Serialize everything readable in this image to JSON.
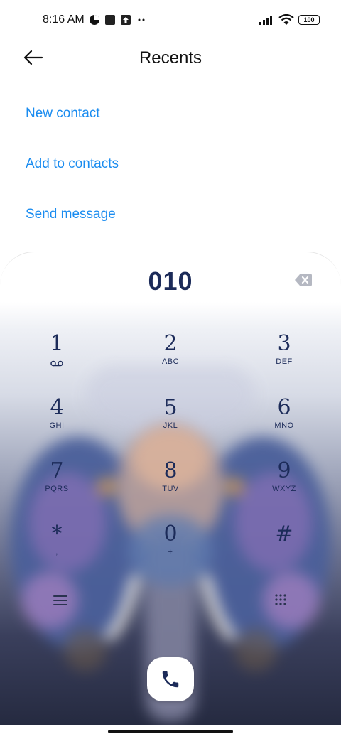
{
  "status_bar": {
    "time": "8:16 AM",
    "battery": "100",
    "icons": [
      "data-saver-icon",
      "square-icon",
      "upload-icon",
      "more-dots-icon",
      "signal-icon",
      "wifi-icon",
      "battery-icon"
    ]
  },
  "header": {
    "title": "Recents",
    "back_icon": "arrow-left-icon"
  },
  "actions": [
    {
      "label": "New contact"
    },
    {
      "label": "Add to contacts"
    },
    {
      "label": "Send message"
    }
  ],
  "dialpad": {
    "number": "010",
    "keys": [
      {
        "digit": "1",
        "letters": ""
      },
      {
        "digit": "2",
        "letters": "ABC"
      },
      {
        "digit": "3",
        "letters": "DEF"
      },
      {
        "digit": "4",
        "letters": "GHI"
      },
      {
        "digit": "5",
        "letters": "JKL"
      },
      {
        "digit": "6",
        "letters": "MNO"
      },
      {
        "digit": "7",
        "letters": "PQRS"
      },
      {
        "digit": "8",
        "letters": "TUV"
      },
      {
        "digit": "9",
        "letters": "WXYZ"
      },
      {
        "digit": "*",
        "letters": ","
      },
      {
        "digit": "0",
        "letters": "+"
      },
      {
        "digit": "#",
        "letters": ""
      }
    ]
  },
  "colors": {
    "accent": "#1a8cf0",
    "digit": "#1c2b59",
    "call_icon": "#1c2b59"
  }
}
